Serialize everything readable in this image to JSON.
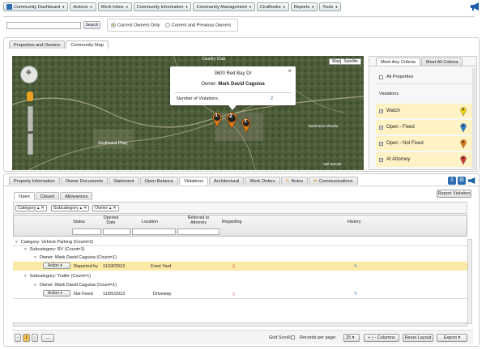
{
  "menu": {
    "items": [
      "Community Dashboard",
      "Actions",
      "Work Inbox",
      "Community Information",
      "Community Management",
      "CiraBooks",
      "Reports",
      "Tools"
    ]
  },
  "search": {
    "button": "Search",
    "value": "",
    "placeholder": ""
  },
  "owner_filter": {
    "options": [
      "Current Owners Only",
      "Current and Previous Owners"
    ],
    "selected": 0
  },
  "upper_tabs": [
    "Properties and Owners",
    "Community Map"
  ],
  "map": {
    "type_buttons": [
      "Map",
      "Satellite"
    ],
    "labels": [
      "Country Club",
      "Southwest Pkwy",
      "Back Door Woods",
      "Vail Woods"
    ],
    "popup": {
      "address": "3600 Red Bay Dr",
      "owner_prefix": "Owner:",
      "owner_name": "Mark David Caguioa",
      "violations_label": "Number of Violations",
      "violations_count": "2",
      "close": "×"
    },
    "markers": [
      "1",
      "2",
      "1"
    ]
  },
  "criteria": {
    "tabs": [
      "Meet Any Criteria",
      "Meet All Criteria"
    ],
    "all_properties": "All Properties",
    "violations_heading": "Violations",
    "items": [
      {
        "label": "Watch",
        "color": "#f2d600"
      },
      {
        "label": "Open - Fixed",
        "color": "#2b7fd6"
      },
      {
        "label": "Open - Not Fixed",
        "color": "#e07a10"
      },
      {
        "label": "At Attorney",
        "color": "#d63b2b"
      }
    ]
  },
  "lower_tabs": [
    "Property Information",
    "Owner Documents",
    "Statement",
    "Open Balance",
    "Violations",
    "Architectural",
    "Work Orders",
    "Notes",
    "Communications"
  ],
  "lower_active_tab": "Violations",
  "sub_tabs": [
    "Open",
    "Closed",
    "Allowances"
  ],
  "report_button": "Report Violation",
  "group_chips": [
    "Category",
    "Subcategory",
    "Owner"
  ],
  "columns": {
    "status": "Status",
    "opened": "Opened\nDate",
    "location": "Location",
    "referred": "Referred to\nAttorney",
    "regarding": "Regarding",
    "history": "History"
  },
  "groups": {
    "category": "Category: Vehicle Parking (Count=2)",
    "sub_rv": "Subcategory: RV (Count=1)",
    "owner_rv": "Owner: Mark David Caguioa (Count=1)",
    "sub_trailer": "Subcategory: Trailer (Count=1)",
    "owner_trailer": "Owner: Mark David Caguioa (Count=1)"
  },
  "rows": [
    {
      "action": "Action",
      "status": "Reported by",
      "date": "11/18/2013",
      "location": "Front Yard"
    },
    {
      "action": "Action",
      "status": "Not Fixed",
      "date": "11/05/2013",
      "location": "Driveway"
    }
  ],
  "footer": {
    "page": "1",
    "grid_scroll": "Grid Scroll:",
    "records_label": "Records per page:",
    "records_value": "25",
    "columns_btn": "+ / - Columns",
    "reset_btn": "Reset Layout",
    "export_btn": "Export"
  }
}
